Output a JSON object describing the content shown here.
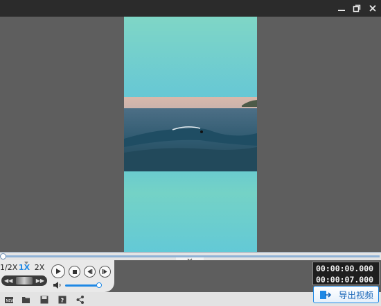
{
  "window": {
    "buttons": [
      "minimize",
      "restore",
      "close"
    ]
  },
  "player": {
    "speed_options": [
      "1/2X",
      "1X",
      "2X"
    ],
    "selected_speed": "1X",
    "progress": 0,
    "volume": 0.9,
    "current_time": "00:00:00.000",
    "total_time": "00:00:07.000"
  },
  "toolbar": {
    "export_label": "导出视频",
    "icons": [
      "new-project-icon",
      "open-folder-icon",
      "save-icon",
      "help-icon",
      "share-icon"
    ]
  },
  "colors": {
    "accent": "#1e88e5",
    "titlebar": "#2b2b2b",
    "background": "#5e5e5e",
    "phone_bg": "#66c7d5"
  }
}
